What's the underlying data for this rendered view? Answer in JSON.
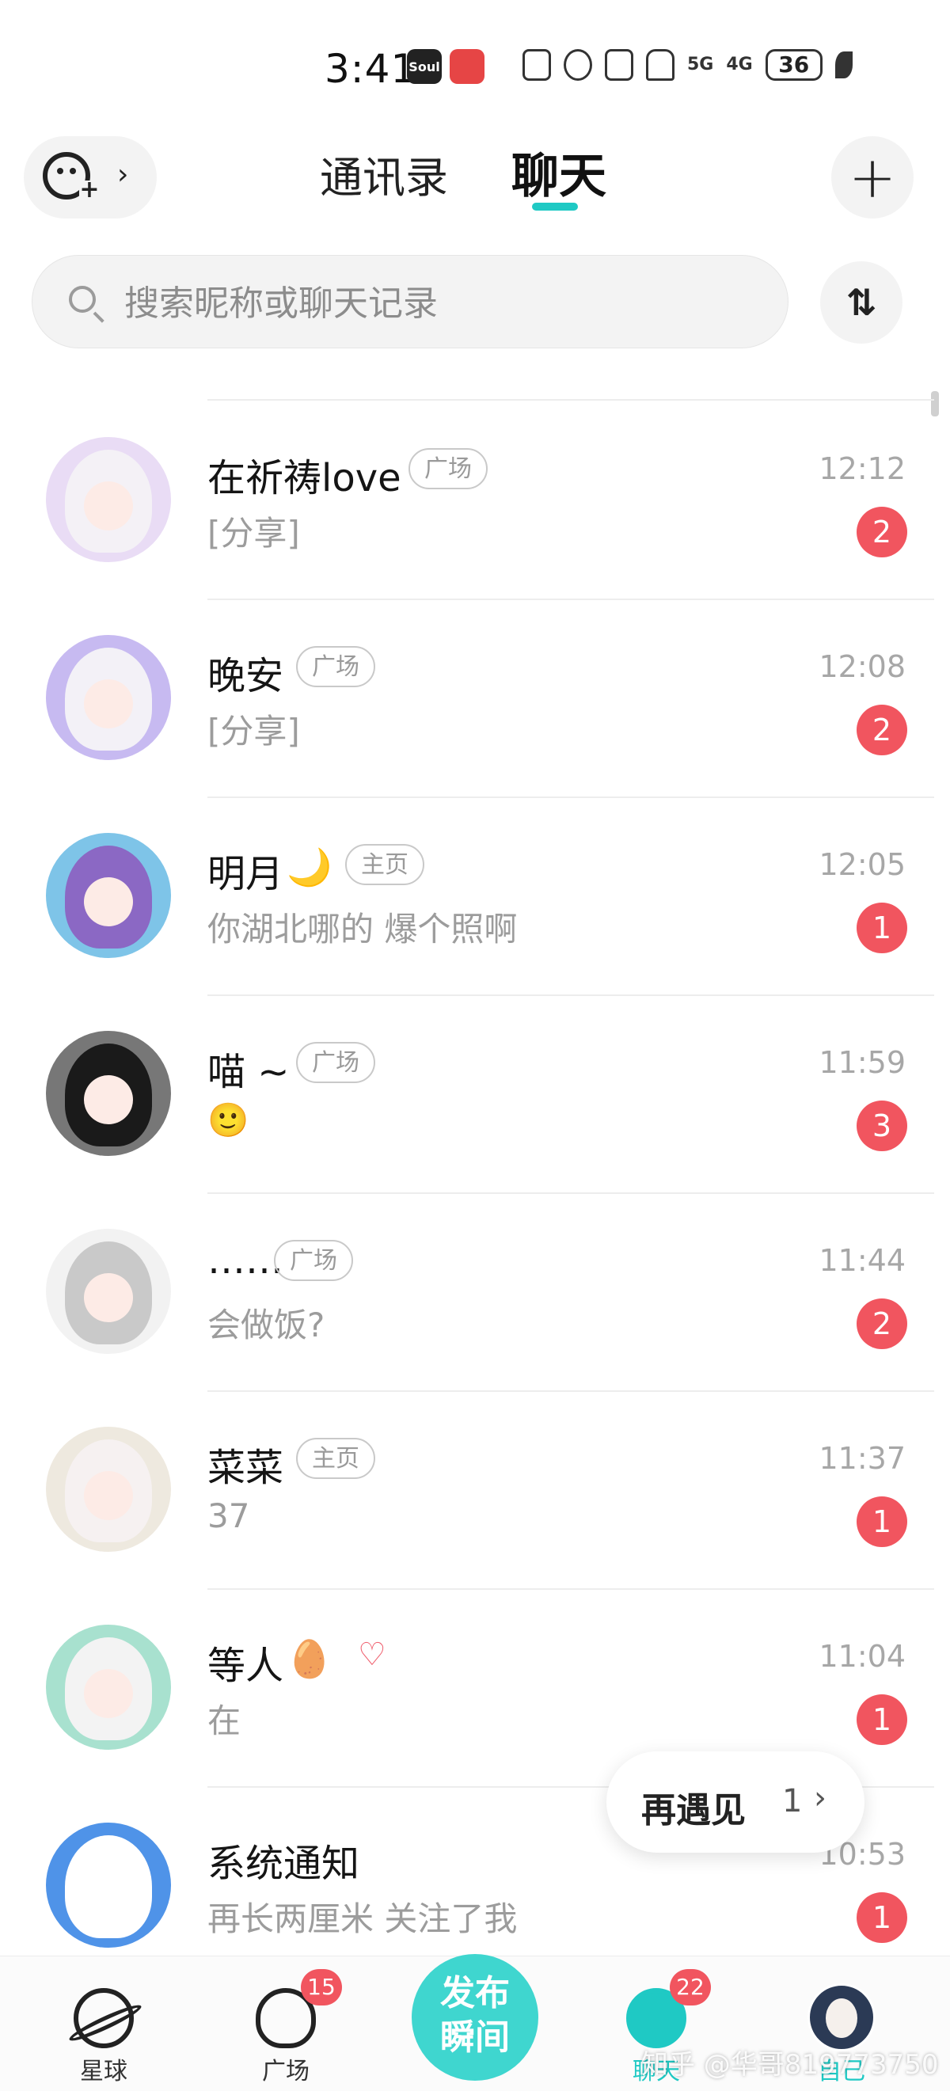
{
  "status_bar": {
    "time": "3:41",
    "app_badges": [
      {
        "name": "soul-app-icon",
        "label": "Soul",
        "color": "#222222"
      },
      {
        "name": "red-app-icon",
        "label": "",
        "color": "#e64545"
      }
    ],
    "net_5g": "5G",
    "net_4g": "4G",
    "battery": "36"
  },
  "header": {
    "tabs": [
      {
        "label": "通讯录",
        "active": false
      },
      {
        "label": "聊天",
        "active": true
      }
    ],
    "accent_color": "#1fc9c4"
  },
  "search": {
    "placeholder": "搜索昵称或聊天记录"
  },
  "chats": [
    {
      "name": "在祈祷love",
      "tag": "广场",
      "message": "[分享]",
      "time": "12:12",
      "unread": "2",
      "avatar_colors": [
        "#e9dcf5",
        "#f4f1f6"
      ]
    },
    {
      "name": "晚安",
      "tag": "广场",
      "message": "[分享]",
      "time": "12:08",
      "unread": "2",
      "avatar_colors": [
        "#c7baf1",
        "#f3f1f7"
      ]
    },
    {
      "name": "明月",
      "emoji": "🌙",
      "tag": "主页",
      "message": "你湖北哪的 爆个照啊",
      "time": "12:05",
      "unread": "1",
      "avatar_colors": [
        "#7ec4e8",
        "#8b68c4"
      ]
    },
    {
      "name": "喵 ~",
      "tag": "广场",
      "message": "🙂",
      "time": "11:59",
      "unread": "3",
      "avatar_colors": [
        "#777777",
        "#1a1a1a"
      ]
    },
    {
      "name": "……",
      "tag": "广场",
      "message": "会做饭?",
      "time": "11:44",
      "unread": "2",
      "avatar_colors": [
        "#f2f2f2",
        "#c9c9c9"
      ]
    },
    {
      "name": "菜菜",
      "tag": "主页",
      "message": "37",
      "time": "11:37",
      "unread": "1",
      "avatar_colors": [
        "#eee9df",
        "#f6f1f1"
      ]
    },
    {
      "name": "等人",
      "emoji": "🥚",
      "heart": true,
      "message": "在",
      "time": "11:04",
      "unread": "1",
      "avatar_colors": [
        "#a8e1cf",
        "#f3f3f3"
      ]
    },
    {
      "name": "系统通知",
      "message": "再长两厘米 关注了我",
      "time": "10:53",
      "unread": "1",
      "avatar_colors": [
        "#4f93e8",
        "#ffffff"
      ]
    }
  ],
  "reunion": {
    "label": "再遇见",
    "count": "1"
  },
  "bottom_nav": {
    "items": [
      {
        "label": "星球"
      },
      {
        "label": "广场",
        "badge": "15"
      },
      {
        "label": "聊天",
        "badge": "22"
      },
      {
        "label": "自己"
      }
    ],
    "publish_line1": "发布",
    "publish_line2": "瞬间"
  },
  "watermark": "知乎 @华哥819773750"
}
